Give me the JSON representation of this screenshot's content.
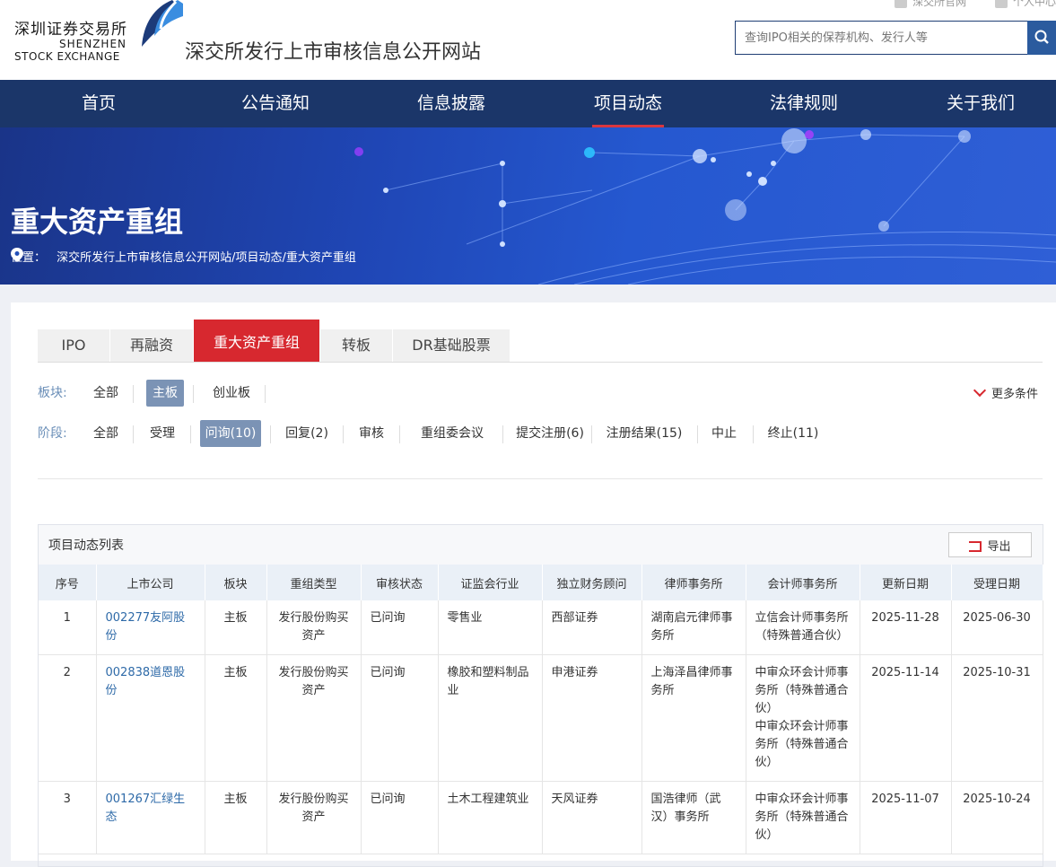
{
  "header": {
    "logo_cn": "深圳证券交易所",
    "logo_en1": "SHENZHEN",
    "logo_en2": "STOCK EXCHANGE",
    "site_title": "深交所发行上市审核信息公开网站",
    "top_links": [
      "深交所官网",
      "个人中心"
    ],
    "search_placeholder": "查询IPO相关的保荐机构、发行人等"
  },
  "nav": [
    "首页",
    "公告通知",
    "信息披露",
    "项目动态",
    "法律规则",
    "关于我们"
  ],
  "nav_active": "项目动态",
  "banner": {
    "title": "重大资产重组",
    "location_label": "位置：",
    "path": "深交所发行上市审核信息公开网站/项目动态/重大资产重组"
  },
  "tabs": [
    "IPO",
    "再融资",
    "重大资产重组",
    "转板",
    "DR基础股票"
  ],
  "tab_active": "重大资产重组",
  "filters": {
    "board_label": "板块:",
    "board_options": [
      "全部",
      "主板",
      "创业板"
    ],
    "board_active": "主板",
    "stage_label": "阶段:",
    "stage_options": [
      "全部",
      "受理",
      "问询(10)",
      "回复(2)",
      "审核",
      "重组委会议",
      "提交注册(6)",
      "注册结果(15)",
      "中止",
      "终止(11)"
    ],
    "stage_active": "问询(10)",
    "more_label": "更多条件"
  },
  "table": {
    "title": "项目动态列表",
    "export_label": "导出",
    "columns": [
      "序号",
      "上市公司",
      "板块",
      "重组类型",
      "审核状态",
      "证监会行业",
      "独立财务顾问",
      "律师事务所",
      "会计师事务所",
      "更新日期",
      "受理日期"
    ],
    "rows": [
      {
        "no": "1",
        "company": "002277友阿股份",
        "board": "主板",
        "type": "发行股份购买资产",
        "status": "已问询",
        "industry": "零售业",
        "advisor": "西部证券",
        "law": "湖南启元律师事务所",
        "accounting": [
          "立信会计师事务所（特殊普通合伙）"
        ],
        "updated": "2025-11-28",
        "accepted": "2025-06-30"
      },
      {
        "no": "2",
        "company": "002838道恩股份",
        "board": "主板",
        "type": "发行股份购买资产",
        "status": "已问询",
        "industry": "橡胶和塑料制品业",
        "advisor": "申港证券",
        "law": "上海泽昌律师事务所",
        "accounting": [
          "中审众环会计师事务所（特殊普通合伙）",
          "中审众环会计师事务所（特殊普通合伙）"
        ],
        "updated": "2025-11-14",
        "accepted": "2025-10-31"
      },
      {
        "no": "3",
        "company": "001267汇绿生态",
        "board": "主板",
        "type": "发行股份购买资产",
        "status": "已问询",
        "industry": "土木工程建筑业",
        "advisor": "天风证券",
        "law": "国浩律师（武汉）事务所",
        "accounting": [
          "中审众环会计师事务所（特殊普通合伙）"
        ],
        "updated": "2025-11-07",
        "accepted": "2025-10-24"
      }
    ]
  },
  "colors": {
    "nav_bg": "#1b3669",
    "accent_red": "#d7282f",
    "active_filter": "#7b93b5",
    "link": "#2e6aa8"
  }
}
